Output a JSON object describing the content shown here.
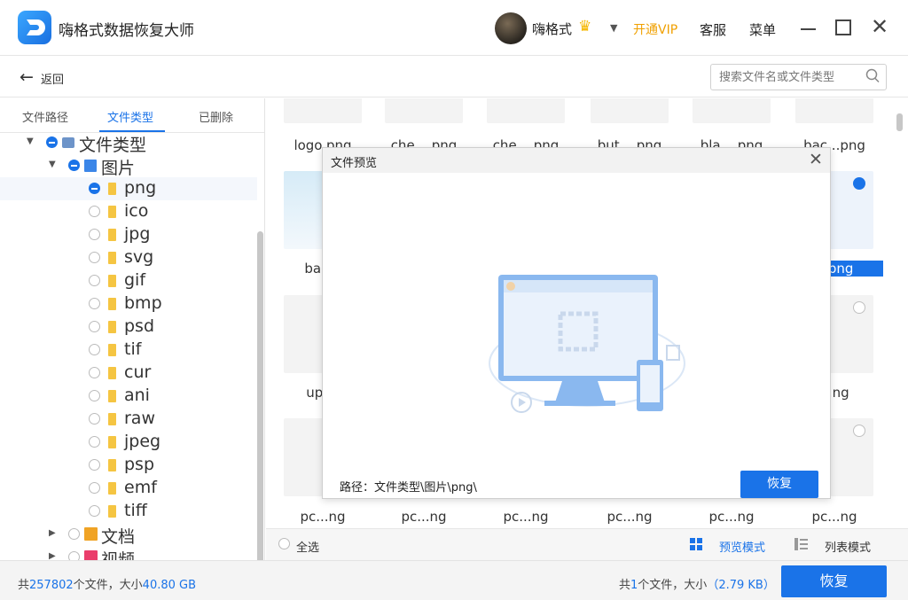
{
  "app": {
    "title": "嗨格式数据恢复大师"
  },
  "user": {
    "name": "嗨格式"
  },
  "header": {
    "vip_label": "开通VIP",
    "service_label": "客服",
    "menu_label": "菜单"
  },
  "toolbar": {
    "back_label": "返回",
    "search_placeholder": "搜索文件名或文件类型"
  },
  "sidebar": {
    "tabs": [
      "文件路径",
      "文件类型",
      "已删除"
    ],
    "active_tab": "文件类型",
    "tree": [
      {
        "label": "文件类型",
        "level": 0,
        "expanded": true,
        "checked": "partial",
        "icon": "category-icon"
      },
      {
        "label": "图片",
        "level": 1,
        "expanded": true,
        "checked": "partial",
        "icon": "image-folder-icon"
      },
      {
        "label": "png",
        "level": 2,
        "checked": "partial",
        "icon": "folder-icon",
        "selected": true
      },
      {
        "label": "ico",
        "level": 2,
        "checked": false,
        "icon": "folder-icon"
      },
      {
        "label": "jpg",
        "level": 2,
        "checked": false,
        "icon": "folder-icon"
      },
      {
        "label": "svg",
        "level": 2,
        "checked": false,
        "icon": "folder-icon"
      },
      {
        "label": "gif",
        "level": 2,
        "checked": false,
        "icon": "folder-icon"
      },
      {
        "label": "bmp",
        "level": 2,
        "checked": false,
        "icon": "folder-icon"
      },
      {
        "label": "psd",
        "level": 2,
        "checked": false,
        "icon": "folder-icon"
      },
      {
        "label": "tif",
        "level": 2,
        "checked": false,
        "icon": "folder-icon"
      },
      {
        "label": "cur",
        "level": 2,
        "checked": false,
        "icon": "folder-icon"
      },
      {
        "label": "ani",
        "level": 2,
        "checked": false,
        "icon": "folder-icon"
      },
      {
        "label": "raw",
        "level": 2,
        "checked": false,
        "icon": "folder-icon"
      },
      {
        "label": "jpeg",
        "level": 2,
        "checked": false,
        "icon": "folder-icon"
      },
      {
        "label": "psp",
        "level": 2,
        "checked": false,
        "icon": "folder-icon"
      },
      {
        "label": "emf",
        "level": 2,
        "checked": false,
        "icon": "folder-icon"
      },
      {
        "label": "tiff",
        "level": 2,
        "checked": false,
        "icon": "folder-icon"
      },
      {
        "label": "文档",
        "level": 1,
        "expanded": false,
        "checked": false,
        "icon": "document-folder-icon"
      },
      {
        "label": "视频",
        "level": 1,
        "expanded": false,
        "checked": false,
        "icon": "video-folder-icon"
      }
    ]
  },
  "grid": {
    "rows": [
      [
        "logo.png",
        "che....png",
        "che....png",
        "but....png",
        "bla....png",
        "bac...png"
      ],
      [
        "bac...",
        "",
        "",
        "",
        "",
        "...png"
      ],
      [
        "upl...",
        "",
        "",
        "",
        "",
        "...ng"
      ],
      [
        "pc...ng",
        "pc...ng",
        "pc...ng",
        "pc...ng",
        "pc...ng",
        "pc...ng"
      ]
    ],
    "selected_item": "...png"
  },
  "footer": {
    "select_all_label": "全选",
    "preview_mode_label": "预览模式",
    "list_mode_label": "列表模式"
  },
  "status": {
    "total_prefix": "共",
    "total_count": "257802",
    "total_mid": "个文件，大小",
    "total_size": "40.80 GB",
    "sel_prefix": "共",
    "sel_count": "1",
    "sel_mid": "个文件，大小",
    "sel_size": "（2.79 KB）",
    "recover_label": "恢复"
  },
  "modal": {
    "title": "文件预览",
    "path_label": "路径：文件类型\\图片\\png\\",
    "recover_label": "恢复"
  },
  "colors": {
    "accent": "#1a73e8",
    "vip": "#f0a000"
  }
}
